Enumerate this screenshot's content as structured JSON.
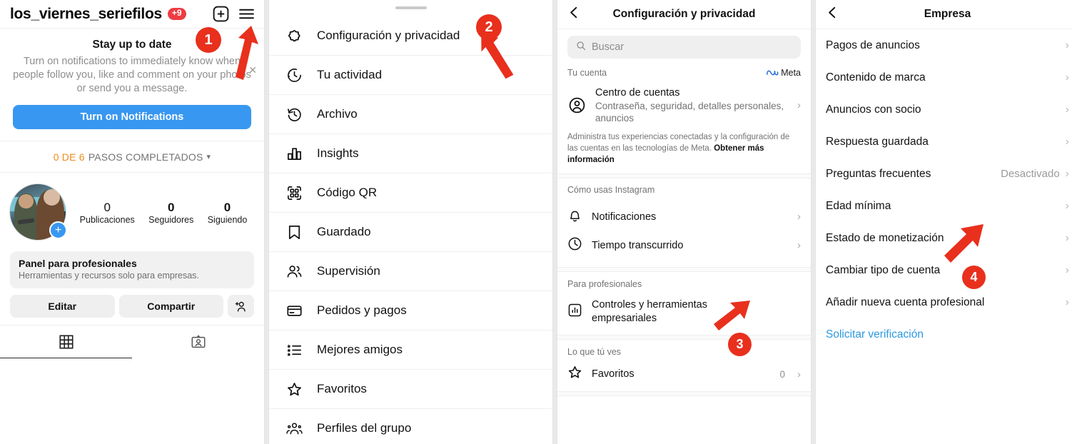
{
  "panel1": {
    "username": "los_viernes_seriefilos",
    "notification_badge": "+9",
    "icons": {
      "add": "plus-square-icon",
      "menu": "hamburger-menu-icon",
      "close": "close-icon"
    },
    "notification_card": {
      "title": "Stay up to date",
      "body": "Turn on notifications to immediately know when people follow you, like and comment on your photos or send you a message.",
      "button": "Turn on Notifications"
    },
    "steps": {
      "prefix": "0 DE 6",
      "label": "PASOS COMPLETADOS",
      "chevron": "⌄"
    },
    "stats": [
      {
        "value": "0",
        "label": "Publicaciones"
      },
      {
        "value": "0",
        "label": "Seguidores"
      },
      {
        "value": "0",
        "label": "Siguiendo"
      }
    ],
    "pro_panel": {
      "title": "Panel para profesionales",
      "subtitle": "Herramientas y recursos solo para empresas."
    },
    "actions": {
      "edit": "Editar",
      "share": "Compartir",
      "add_person": "add-person-icon"
    },
    "tabs": [
      {
        "name": "grid-tab",
        "icon": "grid-icon",
        "active": true
      },
      {
        "name": "tagged-tab",
        "icon": "tagged-person-icon",
        "active": false
      }
    ]
  },
  "panel2": {
    "menu": [
      {
        "label": "Configuración y privacidad",
        "icon": "gear-icon"
      },
      {
        "label": "Tu actividad",
        "icon": "activity-clock-icon"
      },
      {
        "label": "Archivo",
        "icon": "archive-clock-icon"
      },
      {
        "label": "Insights",
        "icon": "bar-chart-icon"
      },
      {
        "label": "Código QR",
        "icon": "qr-code-icon"
      },
      {
        "label": "Guardado",
        "icon": "bookmark-icon"
      },
      {
        "label": "Supervisión",
        "icon": "people-icon"
      },
      {
        "label": "Pedidos y pagos",
        "icon": "credit-card-icon"
      },
      {
        "label": "Mejores amigos",
        "icon": "star-list-icon"
      },
      {
        "label": "Favoritos",
        "icon": "star-icon"
      },
      {
        "label": "Perfiles del grupo",
        "icon": "group-profiles-icon"
      }
    ]
  },
  "panel3": {
    "title": "Configuración y privacidad",
    "back_icon": "back-chevron-icon",
    "search": {
      "placeholder": "Buscar",
      "icon": "search-icon"
    },
    "section_account": {
      "header": "Tu cuenta",
      "brand": "Meta",
      "brand_icon": "meta-infinity-icon"
    },
    "accounts_center": {
      "title": "Centro de cuentas",
      "subtitle": "Contraseña, seguridad, detalles personales, anuncios",
      "icon": "account-circle-icon"
    },
    "note": {
      "text": "Administra tus experiencias conectadas y la configuración de las cuentas en las tecnologías de Meta. ",
      "link": "Obtener más información"
    },
    "section_usage": {
      "header": "Cómo usas Instagram",
      "items": [
        {
          "label": "Notificaciones",
          "icon": "bell-icon"
        },
        {
          "label": "Tiempo transcurrido",
          "icon": "clock-icon"
        }
      ]
    },
    "section_pro": {
      "header": "Para profesionales",
      "items": [
        {
          "label": "Controles y herramientas empresariales",
          "icon": "business-tools-icon"
        }
      ]
    },
    "section_see": {
      "header": "Lo que tú ves",
      "items": [
        {
          "label": "Favoritos",
          "icon": "star-icon",
          "count": "0"
        }
      ]
    }
  },
  "panel4": {
    "title": "Empresa",
    "back_icon": "back-chevron-icon",
    "rows": [
      {
        "label": "Pagos de anuncios",
        "value": ""
      },
      {
        "label": "Contenido de marca",
        "value": ""
      },
      {
        "label": "Anuncios con socio",
        "value": ""
      },
      {
        "label": "Respuesta guardada",
        "value": ""
      },
      {
        "label": "Preguntas frecuentes",
        "value": "Desactivado"
      },
      {
        "label": "Edad mínima",
        "value": ""
      },
      {
        "label": "Estado de monetización",
        "value": ""
      },
      {
        "label": "Cambiar tipo de cuenta",
        "value": ""
      },
      {
        "label": "Añadir nueva cuenta profesional",
        "value": ""
      }
    ],
    "verify_link": "Solicitar verificación"
  },
  "annotations": {
    "color": "#e8301d",
    "steps": [
      "1",
      "2",
      "3",
      "4"
    ]
  }
}
